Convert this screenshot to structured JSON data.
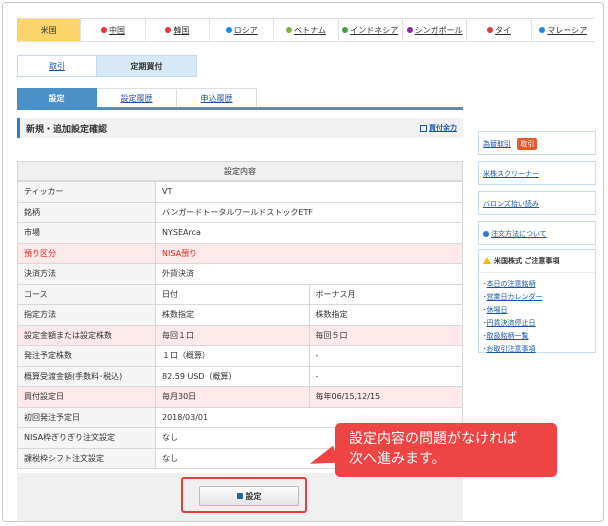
{
  "countries": [
    {
      "label": "米国",
      "active": true,
      "color": "#f5a623"
    },
    {
      "label": "中国",
      "active": false,
      "color": "#e53935"
    },
    {
      "label": "韓国",
      "active": false,
      "color": "#e53935"
    },
    {
      "label": "ロシア",
      "active": false,
      "color": "#1e88e5"
    },
    {
      "label": "ベトナム",
      "active": false,
      "color": "#7cb342"
    },
    {
      "label": "インドネシア",
      "active": false,
      "color": "#43a047"
    },
    {
      "label": "シンガポール",
      "active": false,
      "color": "#8e24aa"
    },
    {
      "label": "タイ",
      "active": false,
      "color": "#e53935"
    },
    {
      "label": "マレーシア",
      "active": false,
      "color": "#1e88e5"
    }
  ],
  "sub_tabs": {
    "trade": "取引",
    "regular": "定期買付"
  },
  "settings_tabs": {
    "settings": "設定",
    "history": "設定履歴",
    "application": "申込履歴"
  },
  "section": {
    "title": "新規・追加設定確認",
    "power_link": "買付余力"
  },
  "table": {
    "header": "設定内容",
    "rows": [
      {
        "label": "ティッカー",
        "value": "VT"
      },
      {
        "label": "銘柄",
        "value": "バンガードトータルワールドストックETF"
      },
      {
        "label": "市場",
        "value": "NYSEArca"
      },
      {
        "label": "預り区分",
        "value": "NISA預り"
      },
      {
        "label": "決済方法",
        "value": "外貨決済"
      },
      {
        "label": "コース",
        "value": "日付",
        "value2": "ボーナス月"
      },
      {
        "label": "指定方法",
        "value": "株数指定",
        "value2": "株数指定"
      },
      {
        "label": "設定金額または設定株数",
        "value": "毎回１口",
        "value2": "毎回５口"
      },
      {
        "label": "発注予定株数",
        "value": "１口（概算）",
        "value2": "-"
      },
      {
        "label": "概算受渡金額(手数料･税込)",
        "value": "82.59 USD（概算）",
        "value2": "-"
      },
      {
        "label": "買付設定日",
        "value": "毎月30日",
        "value2": "毎年06/15,12/15"
      },
      {
        "label": "初回発注予定日",
        "value": "2018/03/01"
      },
      {
        "label": "NISA枠ぎりぎり注文設定",
        "value": "なし"
      },
      {
        "label": "課税枠シフト注文設定",
        "value": "なし"
      }
    ]
  },
  "button": {
    "settei": "設定"
  },
  "callout": {
    "line1": "設定内容の問題がなければ",
    "line2": "次へ進みます。"
  },
  "sidebar": {
    "fx_link": "為替取引",
    "fx_button": "取引",
    "screener": "米株スクリーナー",
    "barons": "バロンズ拾い読み",
    "order_method": "注文方法について",
    "notice_title": "米国株式 ご注意事項",
    "notices": [
      "本日の注意銘柄",
      "営業日カレンダー",
      "休場日",
      "円貨決済停止日",
      "取扱銘柄一覧",
      "お取引注意事項"
    ]
  }
}
